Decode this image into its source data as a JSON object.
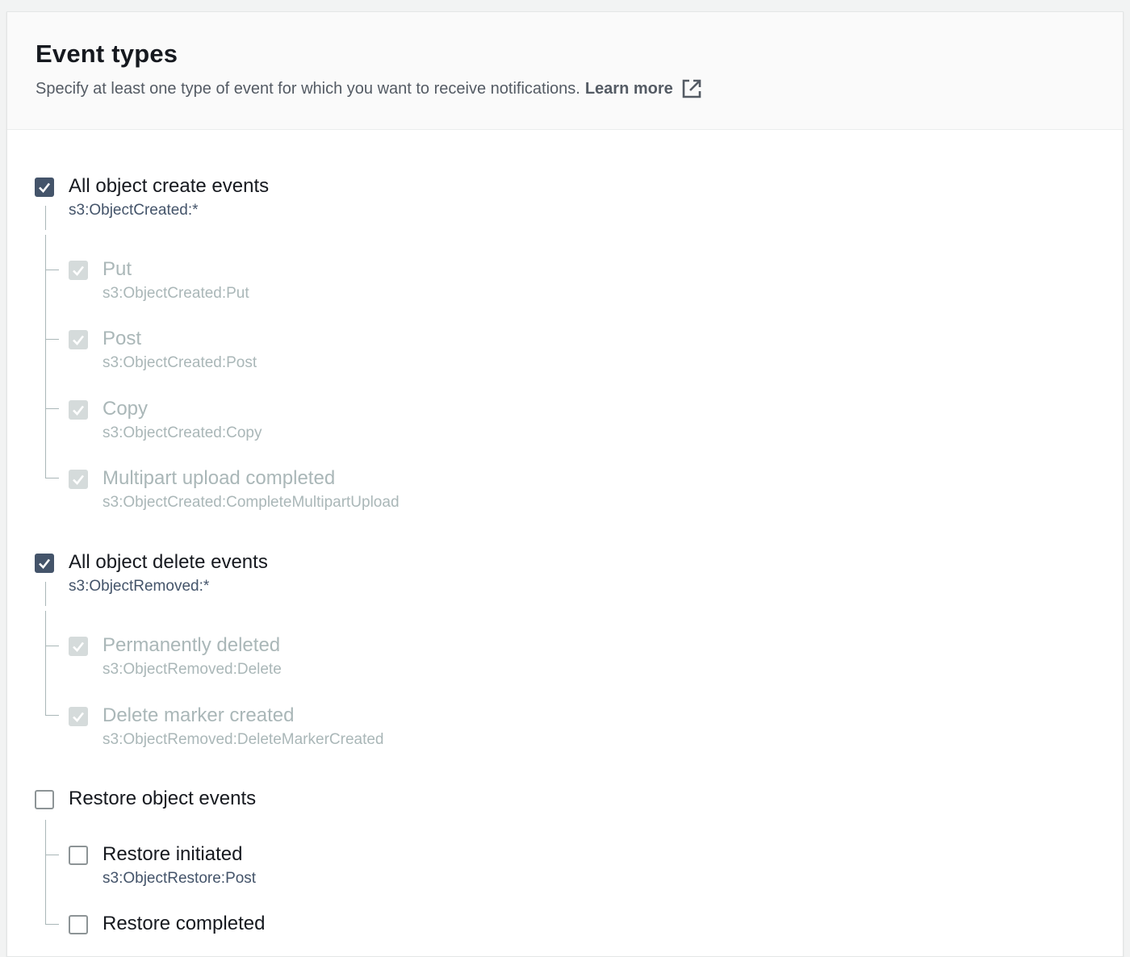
{
  "header": {
    "title": "Event types",
    "description": "Specify at least one type of event for which you want to receive notifications.",
    "learn_more": "Learn more",
    "learn_more_icon": "external-link-icon"
  },
  "colors": {
    "checkbox_checked": "#44546a",
    "checkbox_disabled": "#d5dbdb",
    "event_name": "#44546a",
    "disabled_text": "#aab7b8"
  },
  "groups": [
    {
      "label": "All object create events",
      "event": "s3:ObjectCreated:*",
      "checked": true,
      "children": [
        {
          "label": "Put",
          "event": "s3:ObjectCreated:Put",
          "checked": true,
          "disabled": true
        },
        {
          "label": "Post",
          "event": "s3:ObjectCreated:Post",
          "checked": true,
          "disabled": true
        },
        {
          "label": "Copy",
          "event": "s3:ObjectCreated:Copy",
          "checked": true,
          "disabled": true
        },
        {
          "label": "Multipart upload completed",
          "event": "s3:ObjectCreated:CompleteMultipartUpload",
          "checked": true,
          "disabled": true
        }
      ]
    },
    {
      "label": "All object delete events",
      "event": "s3:ObjectRemoved:*",
      "checked": true,
      "children": [
        {
          "label": "Permanently deleted",
          "event": "s3:ObjectRemoved:Delete",
          "checked": true,
          "disabled": true
        },
        {
          "label": "Delete marker created",
          "event": "s3:ObjectRemoved:DeleteMarkerCreated",
          "checked": true,
          "disabled": true
        }
      ]
    },
    {
      "label": "Restore object events",
      "checked": false,
      "children": [
        {
          "label": "Restore initiated",
          "event": "s3:ObjectRestore:Post",
          "checked": false,
          "disabled": false
        },
        {
          "label": "Restore completed",
          "checked": false,
          "disabled": false
        }
      ]
    }
  ]
}
